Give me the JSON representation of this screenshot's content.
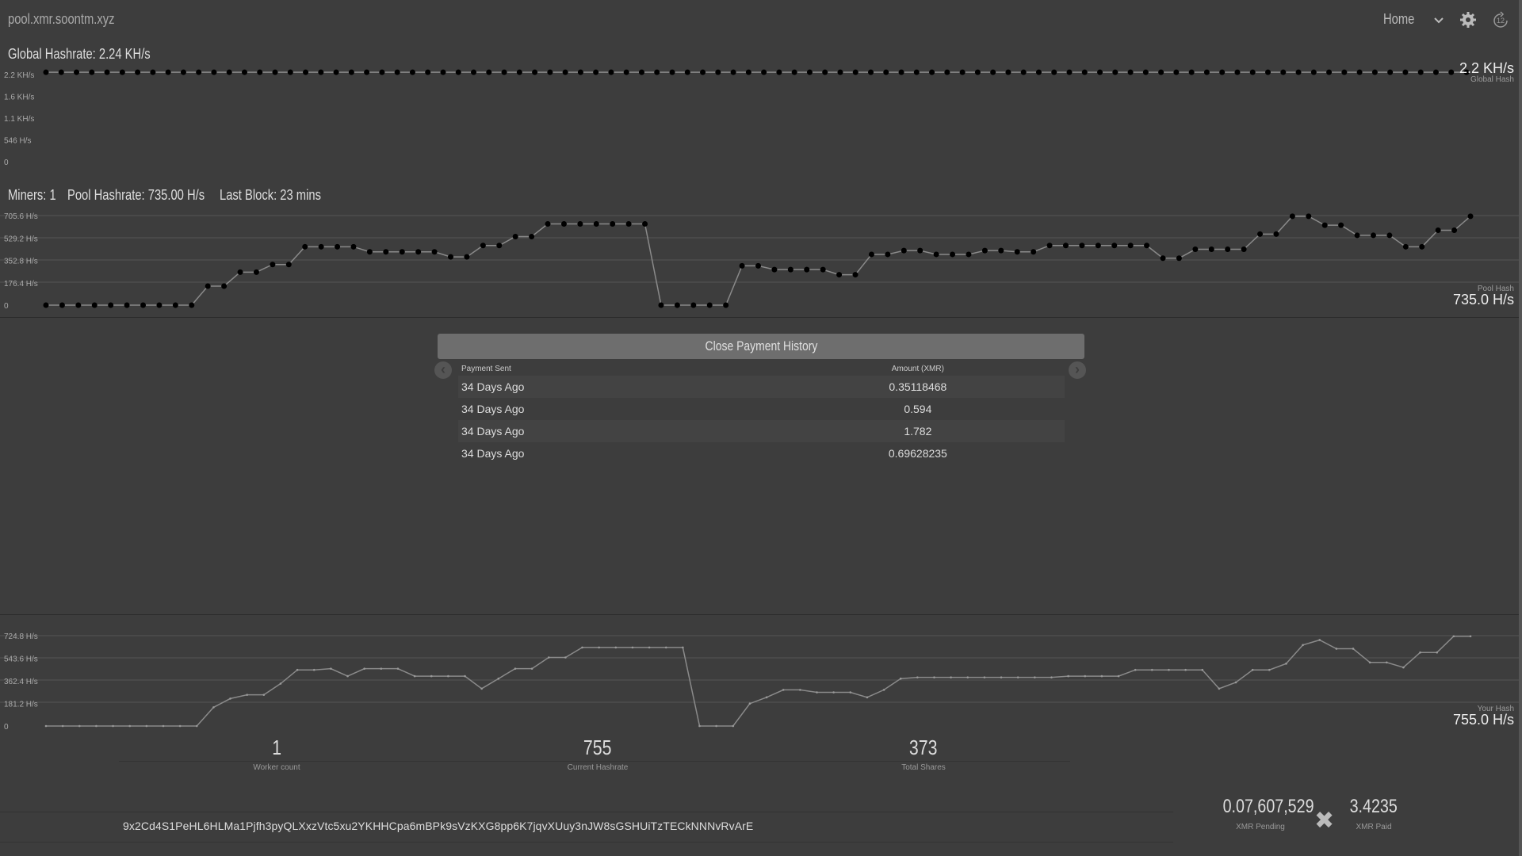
{
  "header": {
    "site_title": "pool.xmr.soontm.xyz",
    "nav_home": "Home",
    "refresh_count": "12"
  },
  "global": {
    "label": "Global Hashrate: 2.24 KH/s",
    "current": "2.2 KH/s",
    "current_label": "Global Hash"
  },
  "pool_stats": {
    "miners": "Miners: 1",
    "pool_hashrate": "Pool Hashrate: 735.00 H/s",
    "last_block": "Last Block: 23 mins",
    "current": "735.0 H/s",
    "current_label": "Pool Hash"
  },
  "user_hash": {
    "current": "755.0 H/s",
    "current_label": "Your Hash"
  },
  "payments": {
    "close_label": "Close Payment History",
    "col_sent": "Payment Sent",
    "col_amount": "Amount (XMR)",
    "rows": [
      {
        "sent": "34 Days Ago",
        "amount": "0.35118468"
      },
      {
        "sent": "34 Days Ago",
        "amount": "0.594"
      },
      {
        "sent": "34 Days Ago",
        "amount": "1.782"
      },
      {
        "sent": "34 Days Ago",
        "amount": "0.69628235"
      }
    ]
  },
  "bottom_stats": {
    "worker_count": "1",
    "worker_count_label": "Worker count",
    "current_hashrate": "755",
    "current_hashrate_label": "Current Hashrate",
    "total_shares": "373",
    "total_shares_label": "Total Shares"
  },
  "wallet": {
    "address": "9x2Cd4S1PeHL6HLMa1Pjfh3pyQLXxzVtc5xu2YKHHCpa6mBPk9sVzKXG8pp6K7jqvXUuy3nJW8sGSHUiTzTECkNNNvRvArE",
    "pending": "0.07,607,529",
    "pending_label": "XMR Pending",
    "paid": "3.4235",
    "paid_label": "XMR Paid"
  },
  "colors": {
    "background": "#3d3d3d",
    "line": "#8a8a8a",
    "dot": "#000000",
    "button": "#6e6e6e"
  },
  "chart_data": [
    {
      "type": "line",
      "name": "Global Hash",
      "y_ticks": [
        "2.2 KH/s",
        "1.6 KH/s",
        "1.1 KH/s",
        "546 H/s",
        "0"
      ],
      "ylim": [
        0,
        2184
      ],
      "values": [
        2240,
        2240,
        2240,
        2240,
        2240,
        2240,
        2240,
        2240,
        2240,
        2240,
        2240,
        2240,
        2240,
        2240,
        2240,
        2240,
        2240,
        2240,
        2240,
        2240,
        2240,
        2240,
        2240,
        2240,
        2240,
        2240,
        2240,
        2240,
        2240,
        2240,
        2240,
        2240,
        2240,
        2240,
        2240,
        2240,
        2240,
        2240,
        2240,
        2240,
        2240,
        2240,
        2240,
        2240,
        2240,
        2240,
        2240,
        2240,
        2240,
        2240,
        2240,
        2240,
        2240,
        2240,
        2240,
        2240,
        2240,
        2240,
        2240,
        2240,
        2240,
        2240,
        2240,
        2240,
        2240,
        2240,
        2240,
        2240,
        2240,
        2240,
        2240,
        2240,
        2240,
        2240,
        2240,
        2240,
        2240,
        2240,
        2240,
        2240,
        2240,
        2240,
        2240,
        2240,
        2240,
        2240,
        2240,
        2240,
        2240,
        2240,
        2240,
        2240,
        2240,
        2240
      ],
      "grid": false
    },
    {
      "type": "line",
      "name": "Pool Hash",
      "y_ticks": [
        "705.6 H/s",
        "529.2 H/s",
        "352.8 H/s",
        "176.4 H/s",
        "0"
      ],
      "ylim": [
        0,
        705.6
      ],
      "values": [
        0,
        0,
        0,
        0,
        0,
        0,
        0,
        0,
        0,
        0,
        150,
        150,
        260,
        260,
        320,
        320,
        460,
        460,
        460,
        460,
        420,
        420,
        420,
        420,
        420,
        380,
        380,
        470,
        470,
        540,
        540,
        640,
        640,
        640,
        640,
        640,
        640,
        640,
        0,
        0,
        0,
        0,
        0,
        310,
        310,
        280,
        280,
        280,
        280,
        240,
        240,
        400,
        400,
        430,
        430,
        400,
        400,
        400,
        430,
        430,
        420,
        420,
        470,
        470,
        470,
        470,
        470,
        470,
        470,
        370,
        370,
        440,
        440,
        440,
        440,
        560,
        560,
        700,
        700,
        630,
        630,
        550,
        550,
        550,
        460,
        460,
        590,
        590,
        700
      ],
      "grid": true
    },
    {
      "type": "line",
      "name": "Your Hash",
      "y_ticks": [
        "724.8 H/s",
        "543.6 H/s",
        "362.4 H/s",
        "181.2 H/s",
        "0"
      ],
      "ylim": [
        0,
        724.8
      ],
      "values": [
        0,
        0,
        0,
        0,
        0,
        0,
        0,
        0,
        0,
        0,
        150,
        220,
        250,
        250,
        340,
        450,
        450,
        460,
        400,
        460,
        460,
        460,
        400,
        400,
        400,
        400,
        300,
        380,
        460,
        460,
        550,
        550,
        630,
        630,
        630,
        630,
        630,
        630,
        630,
        0,
        0,
        0,
        180,
        230,
        290,
        290,
        270,
        270,
        270,
        230,
        290,
        380,
        390,
        390,
        390,
        390,
        390,
        390,
        390,
        390,
        390,
        400,
        400,
        400,
        400,
        450,
        450,
        450,
        450,
        450,
        300,
        350,
        450,
        450,
        500,
        650,
        690,
        620,
        620,
        510,
        510,
        470,
        590,
        590,
        720,
        720
      ],
      "grid": true
    }
  ]
}
